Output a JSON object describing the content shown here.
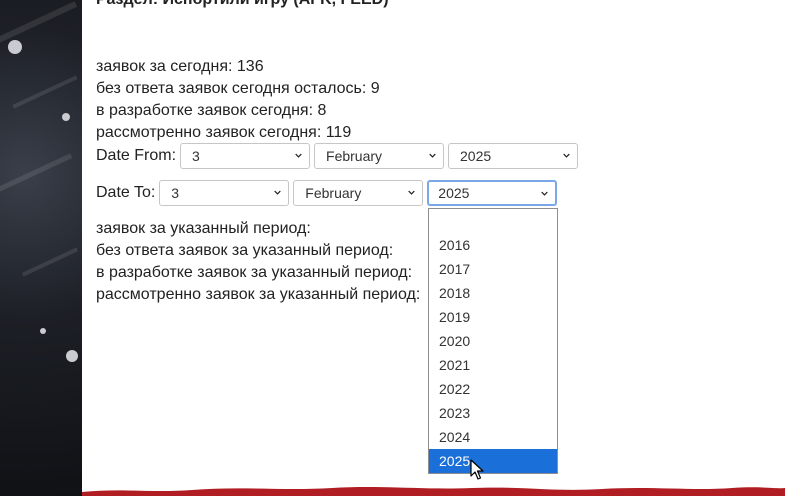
{
  "section": {
    "title": "Раздел: Испортили игру (AFK, FEED)"
  },
  "stats_today": [
    {
      "label": "заявок за сегодня: 136"
    },
    {
      "label": "без ответа заявок сегодня осталось: 9"
    },
    {
      "label": "в разработке заявок сегодня: 8"
    },
    {
      "label": "рассмотренно заявок сегодня: 119"
    }
  ],
  "date_from": {
    "label": "Date From:",
    "day": "3",
    "month": "February",
    "year": "2025"
  },
  "date_to": {
    "label": "Date To:",
    "day": "3",
    "month": "February",
    "year": "2025"
  },
  "stats_period": [
    {
      "label": "заявок за указанный период:"
    },
    {
      "label": "без ответа заявок за указанный период:"
    },
    {
      "label": "в разработке заявок за указанный период:"
    },
    {
      "label": "рассмотренно заявок за указанный период:"
    }
  ],
  "year_dropdown": {
    "options": [
      "",
      "2016",
      "2017",
      "2018",
      "2019",
      "2020",
      "2021",
      "2022",
      "2023",
      "2024",
      "2025"
    ],
    "selected": "2025"
  },
  "colors": {
    "selected_bg": "#1a6fd8",
    "focus_border": "#7aa7e8",
    "footer_red": "#b01e23"
  },
  "icons": {
    "select_arrow": "chevron-down-icon",
    "cursor": "mouse-pointer-icon"
  }
}
